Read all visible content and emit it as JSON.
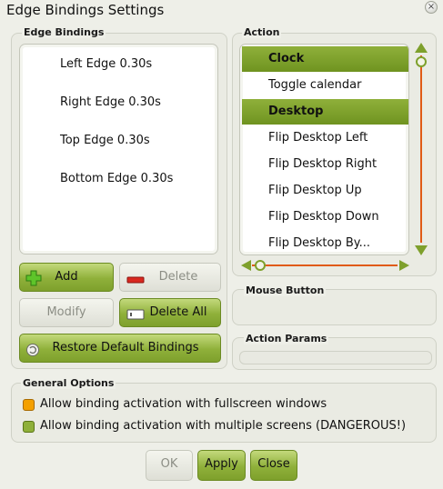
{
  "window": {
    "title": "Edge Bindings Settings",
    "close_glyph": "×"
  },
  "edge_bindings": {
    "label": "Edge Bindings",
    "items": [
      "Left Edge 0.30s",
      "Right Edge 0.30s",
      "Top Edge 0.30s",
      "Bottom Edge 0.30s"
    ]
  },
  "buttons": {
    "add": "Add",
    "delete": "Delete",
    "modify": "Modify",
    "delete_all": "Delete All",
    "restore": "Restore Default Bindings"
  },
  "action": {
    "label": "Action",
    "rows": [
      {
        "text": "Clock",
        "type": "header"
      },
      {
        "text": "Toggle calendar",
        "type": "item"
      },
      {
        "text": "Desktop",
        "type": "header"
      },
      {
        "text": "Flip Desktop Left",
        "type": "item"
      },
      {
        "text": "Flip Desktop Right",
        "type": "item"
      },
      {
        "text": "Flip Desktop Up",
        "type": "item"
      },
      {
        "text": "Flip Desktop Down",
        "type": "item"
      },
      {
        "text": "Flip Desktop By...",
        "type": "item"
      }
    ]
  },
  "mouse_button": {
    "label": "Mouse Button"
  },
  "action_params": {
    "label": "Action Params",
    "value": ""
  },
  "general_options": {
    "label": "General Options",
    "options": [
      {
        "text": "Allow binding activation with fullscreen windows",
        "state": "orange"
      },
      {
        "text": "Allow binding activation with multiple screens (DANGEROUS!)",
        "state": "green"
      }
    ]
  },
  "footer": {
    "ok": "OK",
    "apply": "Apply",
    "close": "Close"
  },
  "colors": {
    "accent": "#7ea02c",
    "scroll_track": "#e05b16",
    "background": "#eeefe8"
  }
}
